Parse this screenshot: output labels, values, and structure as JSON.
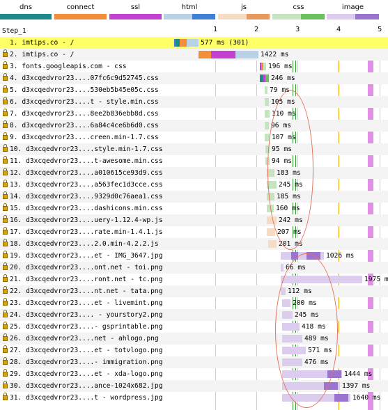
{
  "legend": [
    {
      "label": "dns",
      "color": "#1e8a8c",
      "color2": "#1e8a8c"
    },
    {
      "label": "connect",
      "color": "#f28d3a",
      "color2": "#f28d3a"
    },
    {
      "label": "ssl",
      "color": "#c340d0",
      "color2": "#c340d0"
    },
    {
      "label": "html",
      "color": "#b9d2e8",
      "color2": "#3f7fd6"
    },
    {
      "label": "js",
      "color": "#f6dcc4",
      "color2": "#e89a5e"
    },
    {
      "label": "css",
      "color": "#c6e4c0",
      "color2": "#6ac05a"
    },
    {
      "label": "image",
      "color": "#dccdef",
      "color2": "#9a74cf"
    }
  ],
  "step_label": "Step_1",
  "ticks": [
    "1",
    "2",
    "3",
    "4",
    "5"
  ],
  "rows": [
    {
      "label": "1. imtips.co - /",
      "lock": false,
      "time": "577 ms (301)",
      "highlight": true
    },
    {
      "label": "2. imtips.co - /",
      "lock": true,
      "time": "1422 ms"
    },
    {
      "label": "3. fonts.googleapis.com - css",
      "lock": true,
      "time": "196 ms"
    },
    {
      "label": "4. d3xcqedvror23....07fc6c9d52745.css",
      "lock": true,
      "time": "246 ms"
    },
    {
      "label": "5. d3xcqedvror23....530eb5b45e05c.css",
      "lock": true,
      "time": "79 ms"
    },
    {
      "label": "6. d3xcqedvror23....t - style.min.css",
      "lock": true,
      "time": "105 ms"
    },
    {
      "label": "7. d3xcqedvror23....8ee2b836ebb8d.css",
      "lock": true,
      "time": "110 ms"
    },
    {
      "label": "8. d3xcqedvror23....6a84c4ce6b6d0.css",
      "lock": true,
      "time": "96 ms"
    },
    {
      "label": "9. d3xcqedvror23....creen.min-1.7.css",
      "lock": true,
      "time": "107 ms"
    },
    {
      "label": "10. d3xcqedvror23....style.min-1.7.css",
      "lock": true,
      "time": "95 ms"
    },
    {
      "label": "11. d3xcqedvror23....t-awesome.min.css",
      "lock": true,
      "time": "94 ms"
    },
    {
      "label": "12. d3xcqedvror23....a010615ce93d9.css",
      "lock": true,
      "time": "183 ms"
    },
    {
      "label": "13. d3xcqedvror23....a563fec1d3cce.css",
      "lock": true,
      "time": "245 ms"
    },
    {
      "label": "14. d3xcqedvror23....9329d0c76aea1.css",
      "lock": true,
      "time": "185 ms"
    },
    {
      "label": "15. d3xcqedvror23....dashicons.min.css",
      "lock": true,
      "time": "160 ms"
    },
    {
      "label": "16. d3xcqedvror23....uery-1.12.4-wp.js",
      "lock": true,
      "time": "242 ms"
    },
    {
      "label": "17. d3xcqedvror23....rate.min-1.4.1.js",
      "lock": true,
      "time": "207 ms"
    },
    {
      "label": "18. d3xcqedvror23....2.0.min-4.2.2.js",
      "lock": true,
      "time": "201 ms"
    },
    {
      "label": "19. d3xcqedvror23....et - IMG_3647.jpg",
      "lock": true,
      "time": "1026 ms"
    },
    {
      "label": "20. d3xcqedvror23....ont.net - toi.png",
      "lock": true,
      "time": "66 ms"
    },
    {
      "label": "21. d3xcqedvror23....ront.net - tc.png",
      "lock": true,
      "time": "1975 ms"
    },
    {
      "label": "22. d3xcqedvror23....nt.net - tata.png",
      "lock": true,
      "time": "112 ms"
    },
    {
      "label": "23. d3xcqedvror23....et - livemint.png",
      "lock": true,
      "time": "200 ms"
    },
    {
      "label": "24. d3xcqedvror23.... - yourstory2.png",
      "lock": true,
      "time": "245 ms"
    },
    {
      "label": "25. d3xcqedvror23....- gsprintable.png",
      "lock": true,
      "time": "418 ms"
    },
    {
      "label": "26. d3xcqedvror23....net - ahlogo.png",
      "lock": true,
      "time": "489 ms"
    },
    {
      "label": "27. d3xcqedvror23....et - totvlogo.png",
      "lock": true,
      "time": "571 ms"
    },
    {
      "label": "28. d3xcqedvror23....- immigration.png",
      "lock": true,
      "time": "476 ms"
    },
    {
      "label": "29. d3xcqedvror23....et - xda-logo.png",
      "lock": true,
      "time": "1444 ms"
    },
    {
      "label": "30. d3xcqedvror23....ance-1024x682.jpg",
      "lock": true,
      "time": "1397 ms"
    },
    {
      "label": "31. d3xcqedvror23....t - wordpress.jpg",
      "lock": true,
      "time": "1640 ms"
    }
  ]
}
